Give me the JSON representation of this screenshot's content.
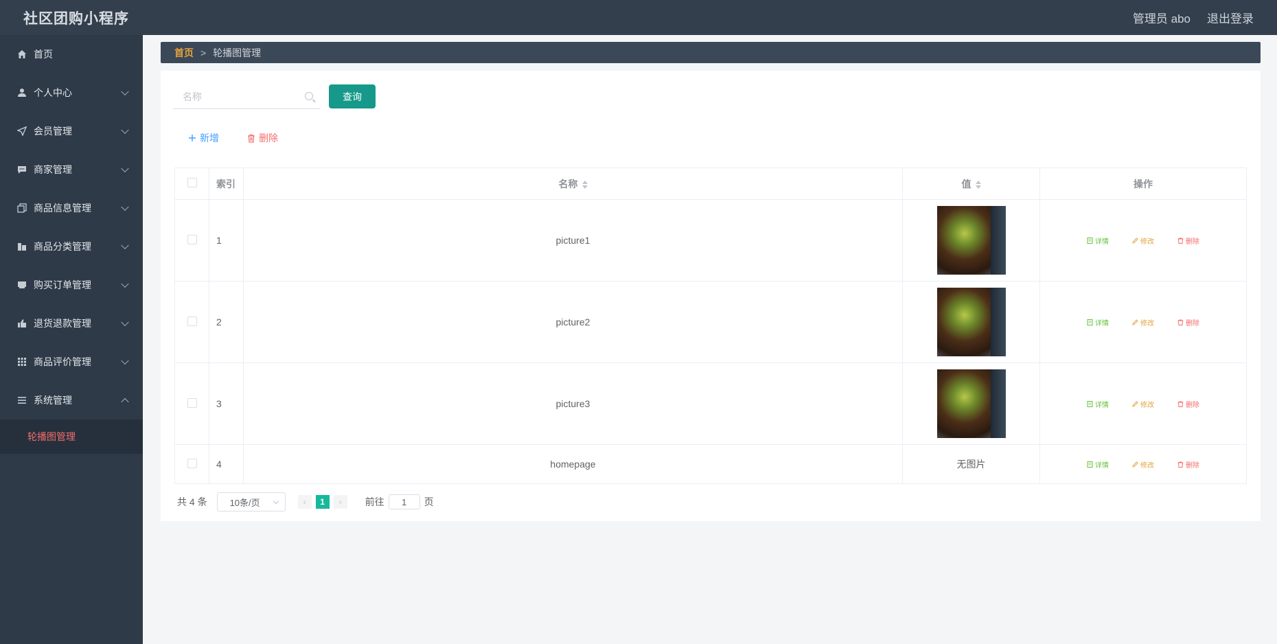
{
  "app": {
    "title": "社区团购小程序",
    "user_label": "管理员 abo",
    "logout_label": "退出登录"
  },
  "sidebar": {
    "items": [
      {
        "label": "首页",
        "icon": "home-icon",
        "expandable": false
      },
      {
        "label": "个人中心",
        "icon": "user-icon",
        "expandable": true
      },
      {
        "label": "会员管理",
        "icon": "send-icon",
        "expandable": true
      },
      {
        "label": "商家管理",
        "icon": "message-icon",
        "expandable": true
      },
      {
        "label": "商品信息管理",
        "icon": "copy-icon",
        "expandable": true
      },
      {
        "label": "商品分类管理",
        "icon": "building-icon",
        "expandable": true
      },
      {
        "label": "购买订单管理",
        "icon": "cart-icon",
        "expandable": true
      },
      {
        "label": "退货退款管理",
        "icon": "thumb-icon",
        "expandable": true
      },
      {
        "label": "商品评价管理",
        "icon": "grid-icon",
        "expandable": true
      },
      {
        "label": "系统管理",
        "icon": "list-icon",
        "expandable": true,
        "expanded": true
      }
    ],
    "active_sub": "轮播图管理"
  },
  "breadcrumb": {
    "home": "首页",
    "separator": ">",
    "current": "轮播图管理"
  },
  "search": {
    "placeholder": "名称",
    "value": "",
    "button_label": "查询"
  },
  "actions": {
    "add_label": "新增",
    "delete_label": "删除"
  },
  "table": {
    "headers": {
      "index": "索引",
      "name": "名称",
      "value": "值",
      "ops": "操作"
    },
    "rows": [
      {
        "index": "1",
        "name": "picture1",
        "has_image": true,
        "value_text": ""
      },
      {
        "index": "2",
        "name": "picture2",
        "has_image": true,
        "value_text": ""
      },
      {
        "index": "3",
        "name": "picture3",
        "has_image": true,
        "value_text": ""
      },
      {
        "index": "4",
        "name": "homepage",
        "has_image": false,
        "value_text": "无图片"
      }
    ],
    "ops": {
      "detail": "详情",
      "edit": "修改",
      "delete": "删除"
    }
  },
  "pagination": {
    "total_label": "共 4 条",
    "page_size_label": "10条/页",
    "current_page": "1",
    "goto_label": "前往",
    "goto_value": "1",
    "page_suffix": "页"
  },
  "colors": {
    "accent": "#16998a",
    "active_menu": "#f56c6c",
    "page_active": "#16b99b",
    "breadcrumb_home": "#e6a23c"
  }
}
